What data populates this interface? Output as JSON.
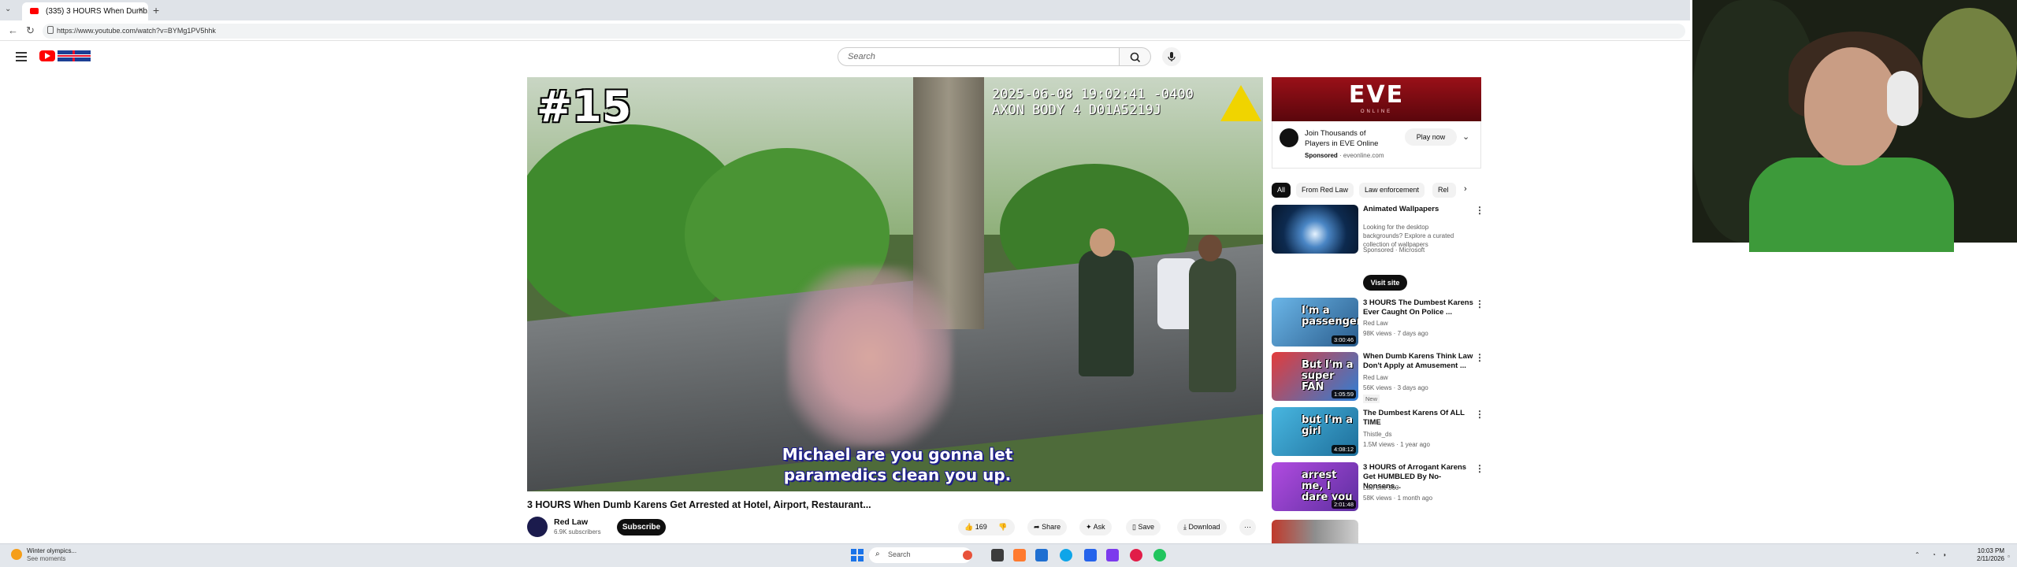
{
  "browser": {
    "tab_title": "(335) 3 HOURS When Dumb...",
    "url": "https://www.youtube.com/watch?v=BYMg1PV5hhk",
    "new_tab_label": "+",
    "tab_close": "×"
  },
  "youtube": {
    "search_placeholder": "Search"
  },
  "video": {
    "overlay_number": "#15",
    "timestamp_line1": "2025-06-08 19:02:41 -0400",
    "timestamp_line2": "AXON BODY 4 D01A5219J",
    "subtitle_line1": "Michael are you gonna let",
    "subtitle_line2": "paramedics clean you up.",
    "title": "3 HOURS When Dumb Karens Get Arrested at Hotel, Airport, Restaurant...",
    "channel_name": "Red Law",
    "channel_subs": "6.9K subscribers",
    "subscribe_label": "Subscribe",
    "like_count": "169",
    "share_label": "Share",
    "ask_label": "Ask",
    "save_label": "Save",
    "download_label": "Download",
    "more_label": "···"
  },
  "ad": {
    "brand": "EVE",
    "brand_sub": "ONLINE",
    "text": "Join Thousands of Players in EVE Online",
    "sponsored": "Sponsored",
    "domain": "· eveonline.com",
    "cta": "Play now"
  },
  "chips": [
    "All",
    "From Red Law",
    "Law enforcement",
    "Rel"
  ],
  "recommendations": [
    {
      "title": "Animated Wallpapers",
      "meta1": "Looking for the desktop backgrounds? Explore a curated collection of wallpapers",
      "meta2": "Sponsored · Microsoft",
      "cta": "Visit site"
    },
    {
      "title": "3 HOURS The Dumbest Karens Ever Caught On Police ...",
      "channel": "Red Law",
      "meta": "98K views · 7 days ago",
      "duration": "3:00:46",
      "thumb_text": "I'm a passenger!"
    },
    {
      "title": "When Dumb Karens Think Law Don't Apply at Amusement ...",
      "channel": "Red Law",
      "meta": "56K views · 3 days ago",
      "badge": "New",
      "duration": "1:05:59",
      "thumb_text": "But I'm a super FAN"
    },
    {
      "title": "The Dumbest Karens Of ALL TIME",
      "channel": "Thistle_ds",
      "meta": "1.5M views · 1 year ago",
      "duration": "4:08:12",
      "thumb_text": "but I'm a girl"
    },
    {
      "title": "3 HOURS of Arrogant Karens Get HUMBLED By No-Nonsens...",
      "channel": "Law Life 360",
      "meta": "58K views · 1 month ago",
      "duration": "2:01:48",
      "thumb_text": "arrest me, I dare you"
    }
  ],
  "taskbar": {
    "weather_line1": "Winter olympics...",
    "weather_line2": "See moments",
    "search_label": "Search",
    "time": "10:03 PM",
    "date": "2/11/2026"
  },
  "colors": {
    "youtube_red": "#ff0000",
    "ad_red": "#9a1018",
    "subscribe_bg": "#0f0f0f"
  }
}
